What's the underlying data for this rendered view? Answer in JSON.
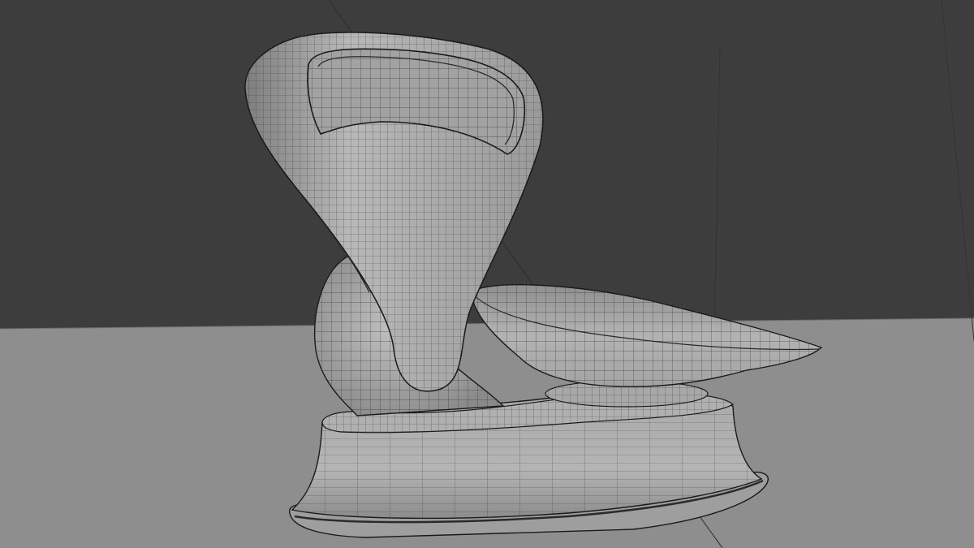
{
  "viewport": {
    "shading": "solid-wireframe",
    "object": "mesh-model",
    "colors": {
      "background": "#3d3d3d",
      "floor": "#8e8e8e",
      "mesh_light": "#b9b9b9",
      "mesh_mid": "#9c9c9c",
      "mesh_dark": "#6f6f6f",
      "wire": "#2a2a2a",
      "outline": "#1a1a1a"
    }
  }
}
